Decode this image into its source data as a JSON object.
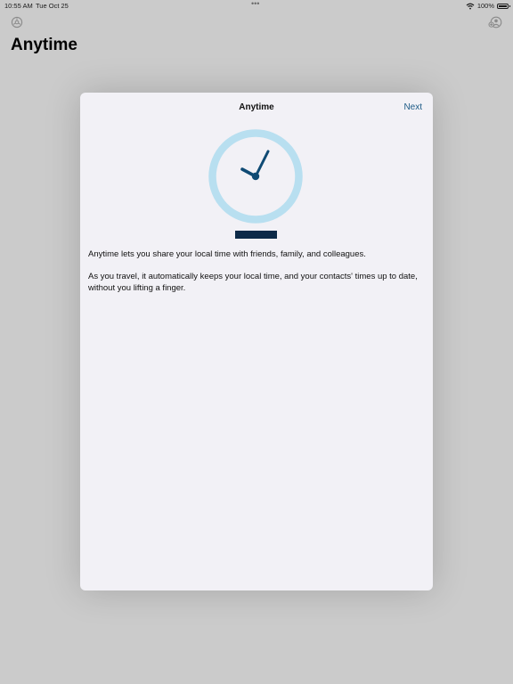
{
  "status_bar": {
    "time": "10:55 AM",
    "date": "Tue Oct 25",
    "dots": "•••",
    "battery_percent": "100%",
    "wifi_icon": "wifi-icon",
    "battery_icon": "battery-full-icon"
  },
  "nav": {
    "left_icon": "settings-gear-icon",
    "right_icon": "contacts-share-icon",
    "large_title": "Anytime"
  },
  "sheet": {
    "title": "Anytime",
    "next_label": "Next",
    "graphic_icon": "clock-icon",
    "paragraphs": [
      "Anytime lets you share your local time with friends, family, and colleagues.",
      "As you travel, it automatically keeps your local time, and your contacts' times up to date, without you lifting a finger."
    ]
  },
  "colors": {
    "accent": "#1c5a86",
    "clock_ring": "#b8dff0",
    "clock_hands": "#0f4a74",
    "clock_base": "#0c2a48",
    "sheet_bg": "#f2f1f6",
    "dimmed_bg": "#cbcbcb"
  }
}
